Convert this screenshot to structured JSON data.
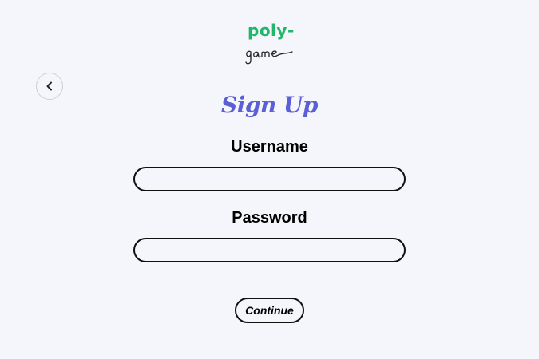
{
  "logo": {
    "top_text": "poly-",
    "bottom_text": "game",
    "top_color": "#21b66a"
  },
  "back_button": {
    "icon": "chevron-left-icon"
  },
  "form": {
    "title": "Sign Up",
    "title_color": "#5b5fd6",
    "username_label": "Username",
    "username_value": "",
    "password_label": "Password",
    "password_value": "",
    "continue_label": "Continue"
  }
}
